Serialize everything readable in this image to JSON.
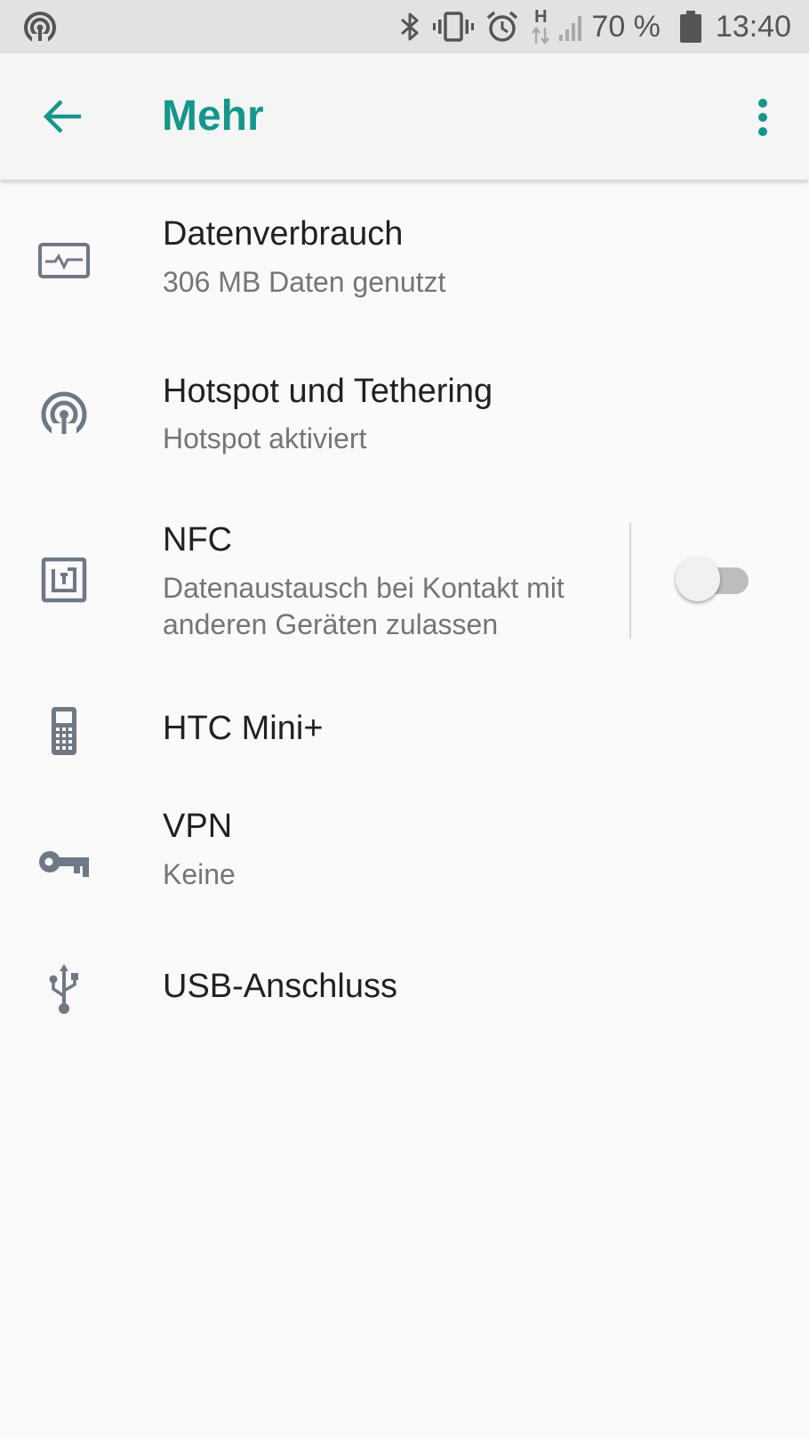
{
  "status_bar": {
    "battery_percent": "70 %",
    "time": "13:40",
    "network_type": "H",
    "icons": [
      "hotspot-icon",
      "bluetooth-icon",
      "vibrate-icon",
      "alarm-icon",
      "network-type-icon",
      "signal-icon",
      "battery-icon"
    ]
  },
  "app_bar": {
    "title": "Mehr",
    "accent_color": "#14968a"
  },
  "items": [
    {
      "title": "Datenverbrauch",
      "subtitle": "306 MB Daten genutzt",
      "icon": "data-usage-icon"
    },
    {
      "title": "Hotspot und Tethering",
      "subtitle": "Hotspot aktiviert",
      "icon": "hotspot-icon"
    },
    {
      "title": "NFC",
      "subtitle_line1": "Datenaustausch bei Kontakt mit",
      "subtitle_line2": "anderen Geräten zulassen",
      "icon": "nfc-icon",
      "toggle_on": false
    },
    {
      "title": "HTC Mini+",
      "icon": "phone-keypad-icon"
    },
    {
      "title": "VPN",
      "subtitle": "Keine",
      "icon": "key-icon"
    },
    {
      "title": "USB-Anschluss",
      "icon": "usb-icon"
    }
  ]
}
